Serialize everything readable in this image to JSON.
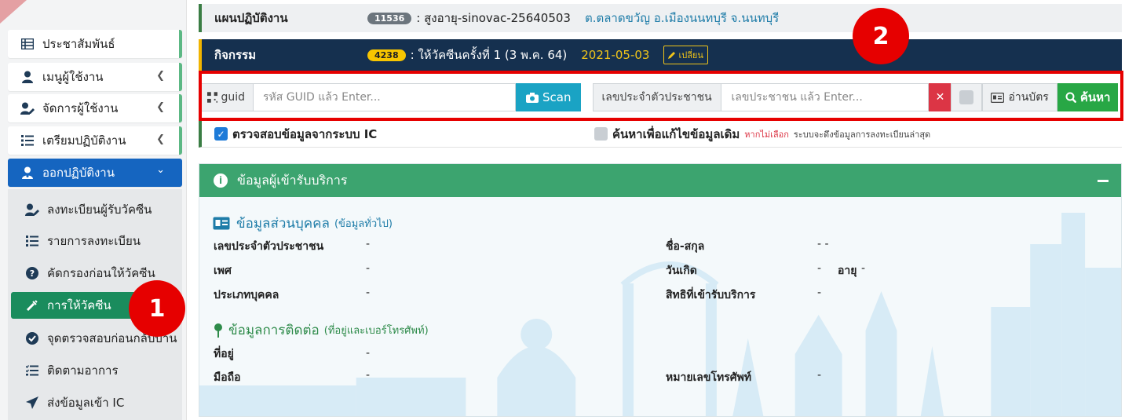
{
  "sidebar": {
    "items": [
      {
        "label": "ประชาสัมพันธ์",
        "icon": "table-icon",
        "chevron": false
      },
      {
        "label": "เมนูผู้ใช้งาน",
        "icon": "user-icon",
        "chevron": true
      },
      {
        "label": "จัดการผู้ใช้งาน",
        "icon": "user-edit-icon",
        "chevron": true
      },
      {
        "label": "เตรียมปฏิบัติงาน",
        "icon": "list-icon",
        "chevron": true
      },
      {
        "label": "ออกปฏิบัติงาน",
        "icon": "user-md-icon",
        "chevron": true,
        "active": true
      }
    ],
    "sub_items": [
      {
        "label": "ลงทะเบียนผู้รับวัคซีน",
        "icon": "user-edit-icon"
      },
      {
        "label": "รายการลงทะเบียน",
        "icon": "list-icon"
      },
      {
        "label": "คัดกรองก่อนให้วัคซีน",
        "icon": "question-icon"
      },
      {
        "label": "การให้วัคซีน",
        "icon": "syringe-icon",
        "active": true
      },
      {
        "label": "จุดตรวจสอบก่อนกลับบ้าน",
        "icon": "check-circle-icon"
      },
      {
        "label": "ติดตามอาการ",
        "icon": "checklist-icon"
      },
      {
        "label": "ส่งข้อมูลเข้า IC",
        "icon": "send-icon"
      }
    ]
  },
  "annotations": {
    "badge1": "1",
    "badge2": "2"
  },
  "plan": {
    "label": "แผนปฏิบัติงาน",
    "id": "11536",
    "value": ": สูงอายุ-sinovac-25640503",
    "location": "ต.ตลาดขวัญ อ.เมืองนนทบุรี จ.นนทบุรี"
  },
  "activity": {
    "label": "กิจกรรม",
    "id": "4238",
    "value": ": ให้วัคซีนครั้งที่ 1 (3 พ.ค. 64)",
    "date": "2021-05-03",
    "change_label": "เปลี่ยน"
  },
  "search": {
    "guid_label": "guid",
    "guid_placeholder": "รหัส GUID แล้ว Enter...",
    "scan_label": "Scan",
    "cid_label": "เลขประจำตัวประชาชน",
    "cid_placeholder": "เลขประชาชน แล้ว Enter...",
    "read_card_label": "อ่านบัตร",
    "search_label": "ค้นหา"
  },
  "options": {
    "check_ic_label": "ตรวจสอบข้อมูลจากระบบ IC",
    "edit_search_label": "ค้นหาเพื่อแก้ไขข้อมูลเดิม",
    "edit_search_warning": "หากไม่เลือก",
    "edit_search_note": "ระบบจะดึงข้อมูลการลงทะเบียนล่าสุด"
  },
  "panel": {
    "title": "ข้อมูลผู้เข้ารับบริการ",
    "personal_title": "ข้อมูลส่วนบุคคล",
    "personal_sub": "(ข้อมูลทั่วไป)",
    "fields": {
      "cid": {
        "label": "เลขประจำตัวประชาชน",
        "value": "-"
      },
      "fullname": {
        "label": "ชื่อ-สกุล",
        "value": "- -"
      },
      "gender": {
        "label": "เพศ",
        "value": "-"
      },
      "birthdate": {
        "label": "วันเกิด",
        "value": "-"
      },
      "age": {
        "label": "อายุ",
        "value": "-"
      },
      "person_type": {
        "label": "ประเภทบุคคล",
        "value": "-"
      },
      "right": {
        "label": "สิทธิที่เข้ารับบริการ",
        "value": "-"
      }
    },
    "contact_title": "ข้อมูลการติดต่อ",
    "contact_sub": "(ที่อยู่และเบอร์โทรศัพท์)",
    "contact": {
      "address": {
        "label": "ที่อยู่",
        "value": "-"
      },
      "mobile": {
        "label": "มือถือ",
        "value": "-"
      },
      "phone": {
        "label": "หมายเลขโทรศัพท์",
        "value": "-"
      }
    }
  }
}
